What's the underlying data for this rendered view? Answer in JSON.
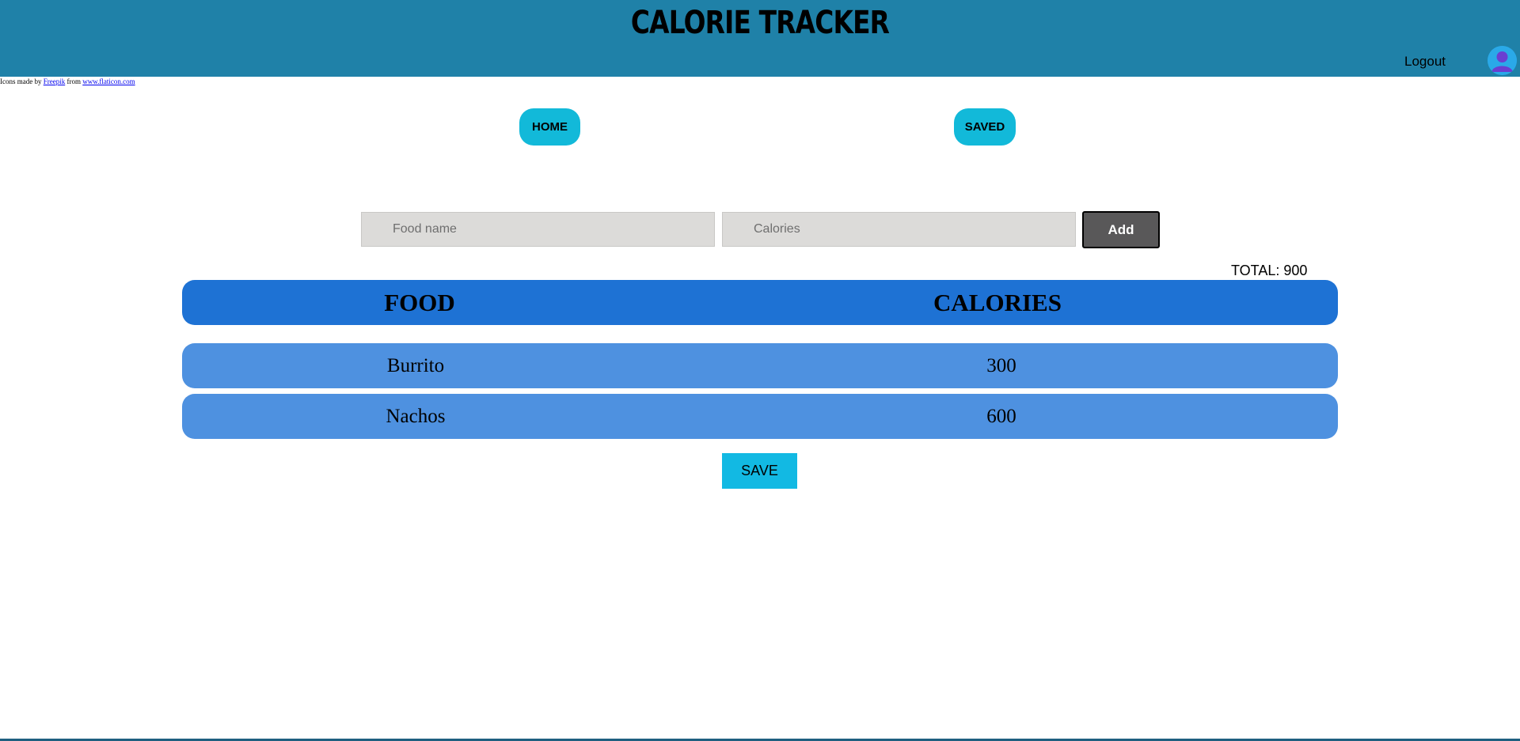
{
  "header": {
    "title": "CALORIE TRACKER",
    "logout_label": "Logout",
    "avatar_icon": "user-avatar-icon",
    "background_color": "#1f81a8"
  },
  "attribution": {
    "prefix": "Icons made by ",
    "author_link": "Freepik",
    "middle": " from ",
    "site_link": "www.flaticon.com"
  },
  "nav": {
    "home_label": "HOME",
    "saved_label": "SAVED",
    "button_color": "#12b9d9"
  },
  "form": {
    "food_placeholder": "Food name",
    "calories_placeholder": "Calories",
    "food_value": "",
    "calories_value": "",
    "add_label": "Add"
  },
  "total": {
    "label": "TOTAL: 900"
  },
  "table": {
    "headers": [
      "FOOD",
      "CALORIES"
    ],
    "rows": [
      {
        "food": "Burrito",
        "calories": "300"
      },
      {
        "food": "Nachos",
        "calories": "600"
      }
    ],
    "header_color": "#1e72d4",
    "row_color": "#4e91e0"
  },
  "save": {
    "label": "SAVE",
    "color": "#12b9e3"
  }
}
